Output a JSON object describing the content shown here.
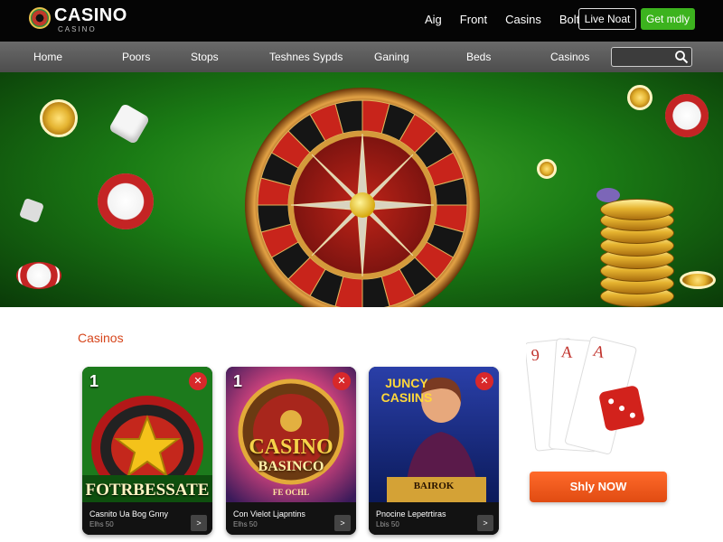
{
  "header": {
    "logo_main": "CASINO",
    "logo_sub": "CASINO",
    "links": [
      "Aig",
      "Front",
      "Casins",
      "Bolt"
    ],
    "live_label": "Live Noat",
    "get_label": "Get mdly"
  },
  "nav": {
    "items": [
      "Home",
      "Poors",
      "Stops",
      "Teshnes Sypds",
      "Ganing",
      "Beds",
      "Casinos"
    ],
    "search_placeholder": ""
  },
  "section": {
    "title": "Casinos"
  },
  "cards": [
    {
      "number": "1",
      "art_text": "FOTRBESSATE",
      "title": "Casnito Ua Bog Gnny",
      "sub": "Elhs 50"
    },
    {
      "number": "1",
      "art_text_1": "CASINO",
      "art_text_2": "BASINCO",
      "art_caption": "FE OCHL",
      "title": "Con Vielot Ljapntins",
      "sub": "Elhs 50"
    },
    {
      "art_text_1": "JUNCY",
      "art_text_2": "CASIINS",
      "art_caption": "BAIROK",
      "title": "Pnocine Lepetrtiras",
      "sub": "Lbis 50"
    }
  ],
  "sidebar": {
    "cards": [
      "9",
      "A",
      "A"
    ],
    "play_label": "Shly NOW"
  },
  "colors": {
    "accent_green": "#3cb31e",
    "accent_orange": "#e04b12",
    "section_title": "#d6451b"
  }
}
